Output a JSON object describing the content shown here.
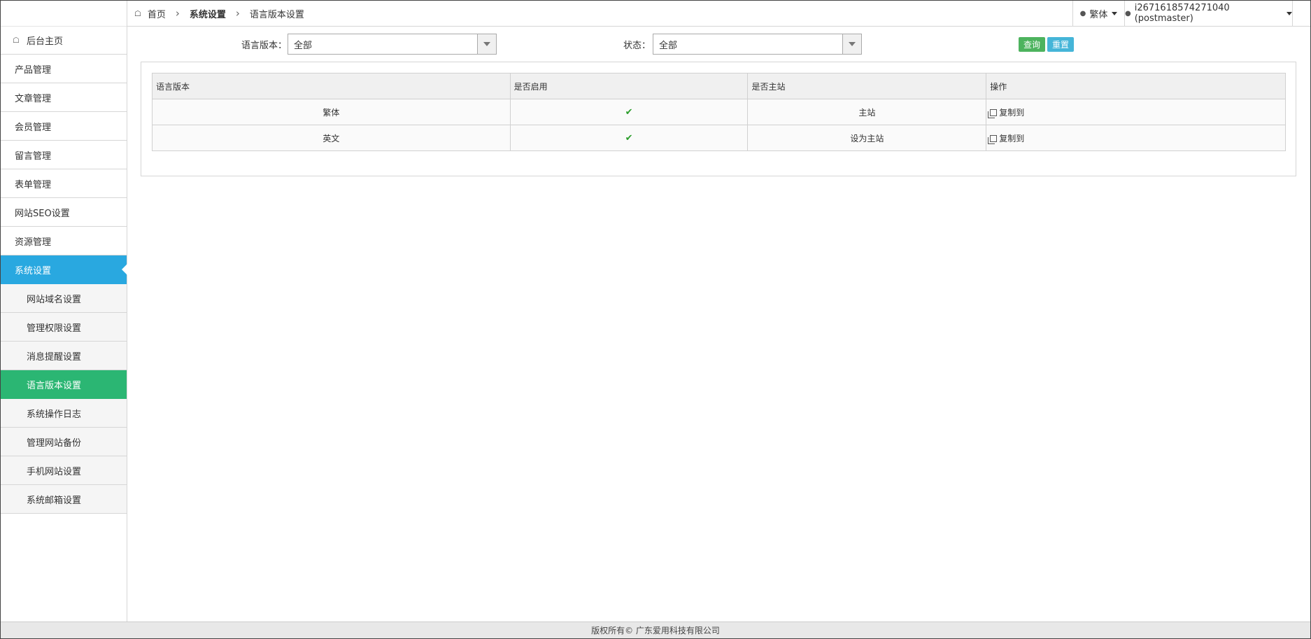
{
  "header": {
    "breadcrumb": {
      "home": "首页",
      "section": "系统设置",
      "page": "语言版本设置"
    },
    "language_menu": "繁体",
    "user_menu": "i2671618574271040 (postmaster)"
  },
  "sidebar": {
    "home": "后台主页",
    "items": [
      {
        "label": "产品管理"
      },
      {
        "label": "文章管理"
      },
      {
        "label": "会员管理"
      },
      {
        "label": "留言管理"
      },
      {
        "label": "表单管理"
      },
      {
        "label": "网站SEO设置"
      },
      {
        "label": "资源管理"
      },
      {
        "label": "系统设置"
      }
    ],
    "sub_items": [
      {
        "label": "网站域名设置"
      },
      {
        "label": "管理权限设置"
      },
      {
        "label": "消息提醒设置"
      },
      {
        "label": "语言版本设置"
      },
      {
        "label": "系统操作日志"
      },
      {
        "label": "管理网站备份"
      },
      {
        "label": "手机网站设置"
      },
      {
        "label": "系统邮箱设置"
      }
    ]
  },
  "filters": {
    "language_label": "语言版本：",
    "language_value": "全部",
    "status_label": "状态：",
    "status_value": "全部",
    "query_button": "查询",
    "reset_button": "重置"
  },
  "table": {
    "columns": [
      "语言版本",
      "是否启用",
      "是否主站",
      "操作"
    ],
    "rows": [
      {
        "language": "繁体",
        "enabled": "✔",
        "main_site": "主站",
        "action": "复制到"
      },
      {
        "language": "英文",
        "enabled": "✔",
        "main_site": "设为主站",
        "action": "复制到"
      }
    ]
  },
  "footer": {
    "copyright": "版权所有© 广东爱用科技有限公司"
  },
  "colors": {
    "active_menu": "#29a8e0",
    "current_submenu": "#2bb673",
    "query_button": "#4db35e",
    "reset_button": "#45b5d8"
  }
}
